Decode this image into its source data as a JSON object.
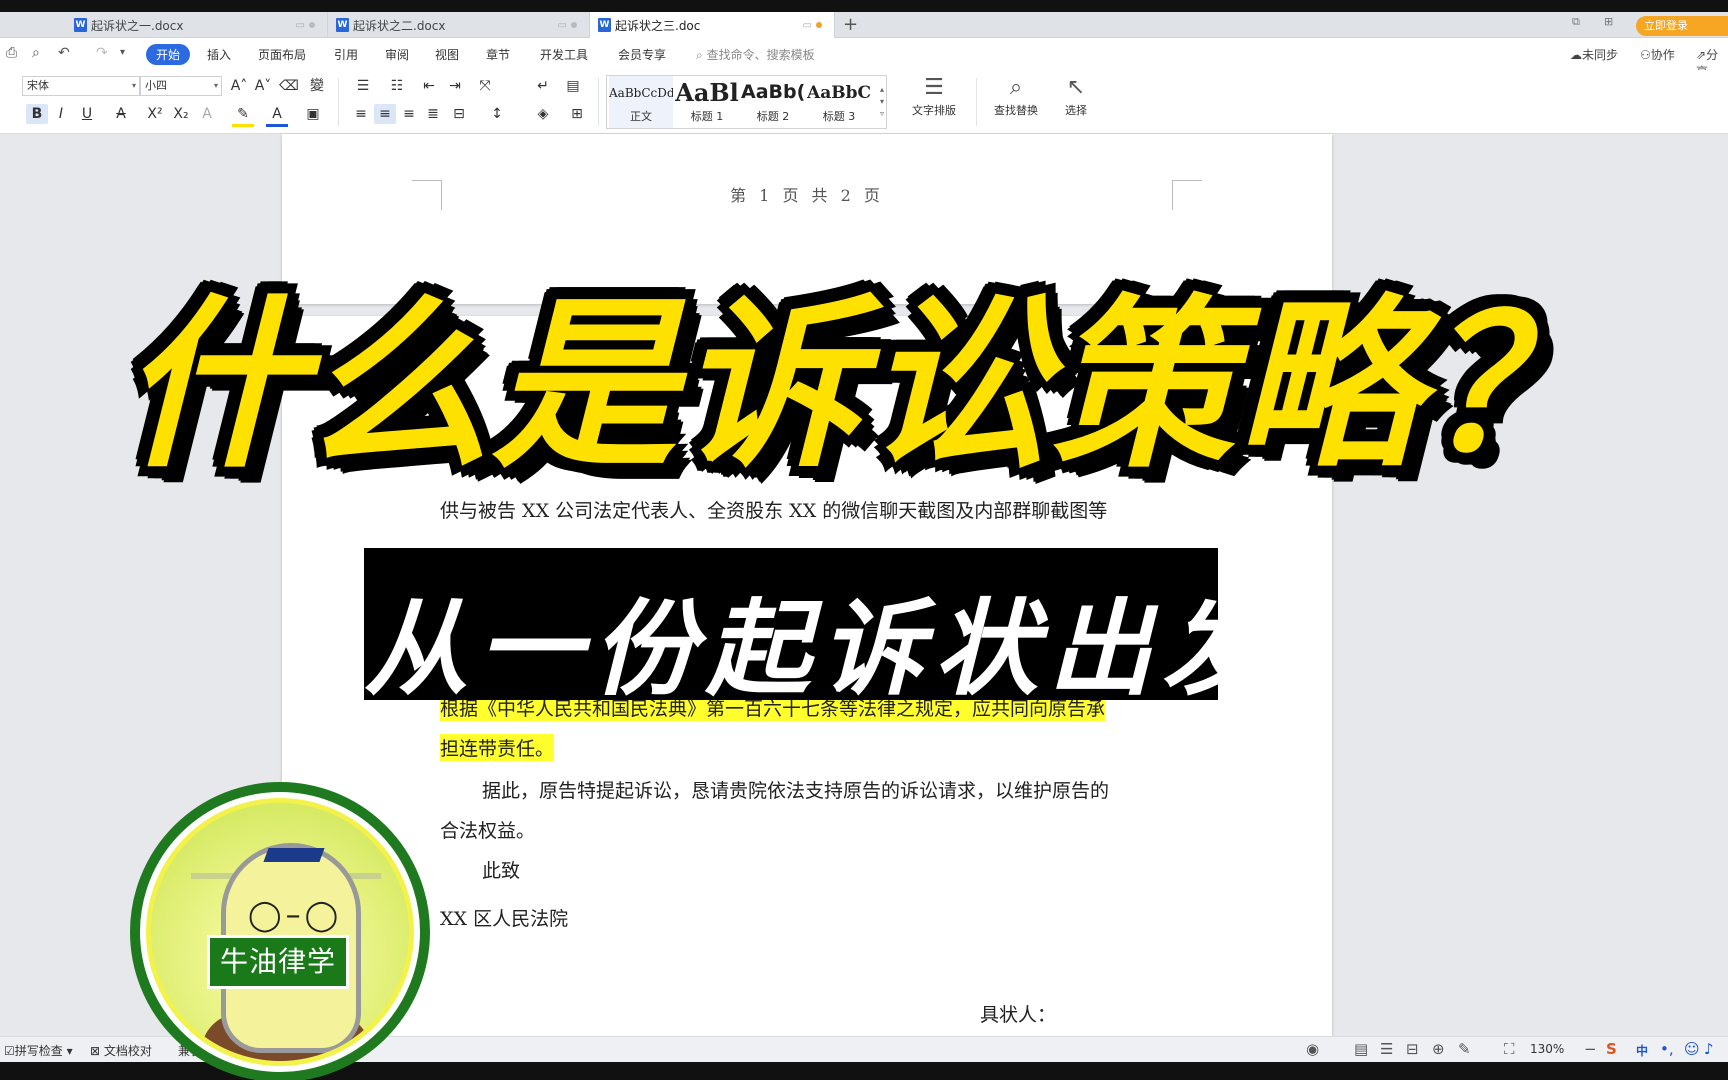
{
  "tabs": [
    {
      "name": "起诉状之一.docx",
      "active": false
    },
    {
      "name": "起诉状之二.docx",
      "active": false
    },
    {
      "name": "起诉状之三.doc",
      "active": true
    }
  ],
  "window": {
    "login_label": "立即登录"
  },
  "menu": {
    "items": [
      "开始",
      "插入",
      "页面布局",
      "引用",
      "审阅",
      "视图",
      "章节",
      "开发工具",
      "会员专享"
    ],
    "search_placeholder": "查找命令、搜索模板",
    "unsynced": "未同步",
    "collab": "协作",
    "share": "分享"
  },
  "ribbon": {
    "font_name": "宋体",
    "font_size": "小四",
    "styles": [
      {
        "preview": "AaBbCcDd",
        "label": "正文"
      },
      {
        "preview": "AaBl",
        "label": "标题 1"
      },
      {
        "preview": "AaBb(",
        "label": "标题 2"
      },
      {
        "preview": "AaBbC",
        "label": "标题 3"
      }
    ],
    "text_layout": "文字排版",
    "find_replace": "查找替换",
    "select": "选择"
  },
  "document": {
    "page_header": "第 1 页 共 2 页",
    "line_evidence": "供与被告 XX 公司法定代表人、全资股东 XX 的微信聊天截图及内部群聊截图等",
    "line_law_1": "根据《中华人民共和国民法典》第一百六十七条等法律之规定，应共同向原告承",
    "line_law_2": "担连带责任。",
    "line_request_1": "据此，原告特提起诉讼，恳请贵院依法支持原告的诉讼请求，以维护原告的",
    "line_request_2": "合法权益。",
    "line_salute": "此致",
    "line_court": "XX 区人民法院",
    "line_signer": "具状人："
  },
  "overlay": {
    "title": "什么是诉讼策略？",
    "subtitle": "从一份起诉状出发"
  },
  "logo": {
    "name": "牛油律学"
  },
  "status": {
    "spellcheck": "拼写检查",
    "doc_check": "文档校对",
    "compat": "兼容",
    "zoom": "130%",
    "ime": "中"
  },
  "colors": {
    "accent": "#2b6ae0",
    "title_yellow": "#ffe100",
    "highlight": "#ffff2e",
    "logo_green": "#1f7a1f"
  }
}
